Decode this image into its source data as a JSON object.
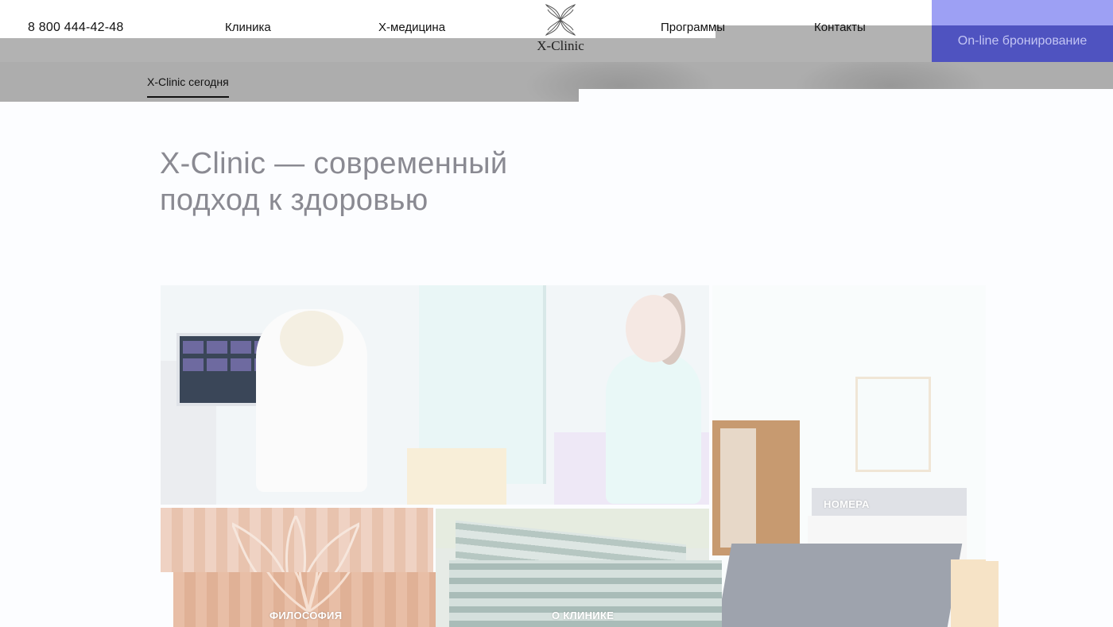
{
  "header": {
    "phone": "8 800 444-42-48",
    "nav": [
      "Клиника",
      "X-медицина",
      "Программы",
      "Контакты"
    ],
    "logo_text": "X-Clinic",
    "book_button": "On-line бронирование"
  },
  "subnav": {
    "active_tab": "X-Clinic сегодня"
  },
  "hero": {
    "title_line1": "X-Clinic — современный",
    "title_line2": "подход к здоровью"
  },
  "tiles": {
    "rooms": "НОМЕРА",
    "philosophy": "ФИЛОСОФИЯ",
    "about": "О КЛИНИКЕ"
  },
  "colors": {
    "accent": "#4f53c0",
    "accent_light": "#9da0f4",
    "title": "#8a8a92"
  },
  "icons": {
    "logo": "butterfly-leaf-icon"
  }
}
